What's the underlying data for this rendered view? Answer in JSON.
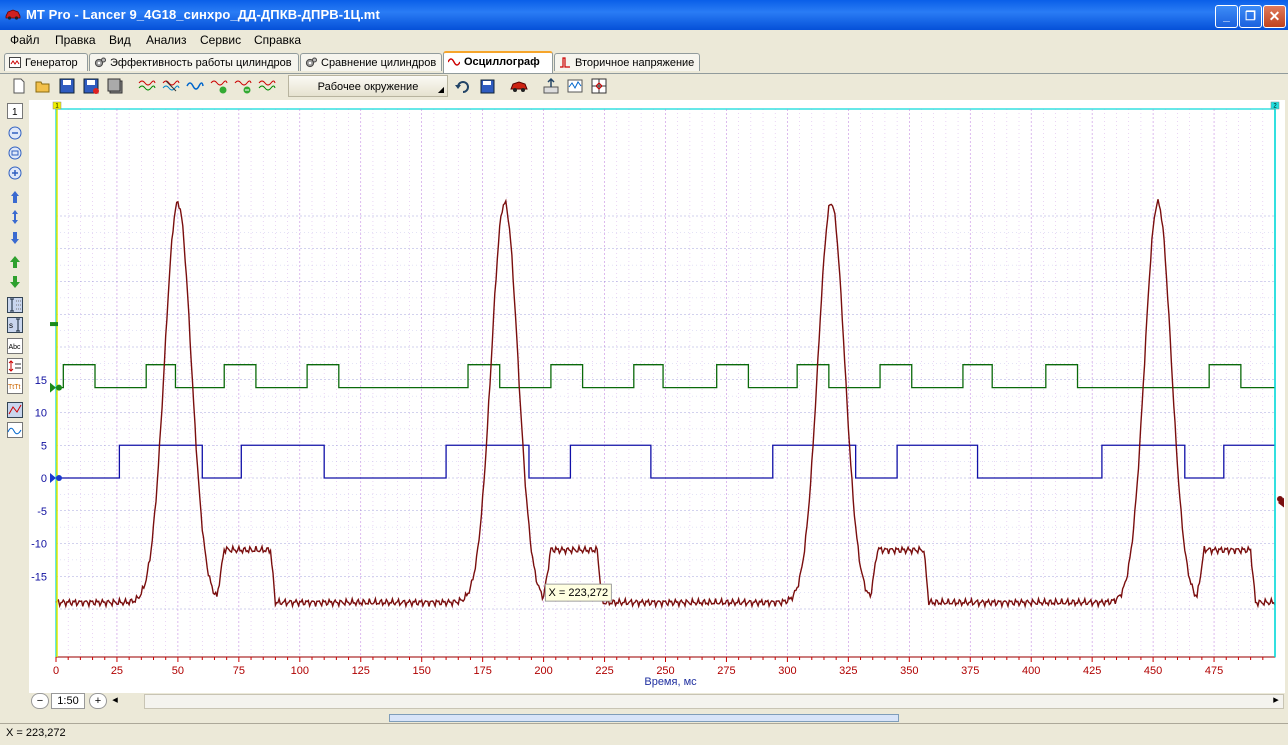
{
  "window": {
    "title": "MT Pro - Lancer 9_4G18_синхро_ДД-ДПКВ-ДПРВ-1Ц.mt",
    "buttons": [
      "minimize-icon",
      "restore-icon",
      "close-icon"
    ]
  },
  "menu": [
    "Файл",
    "Правка",
    "Вид",
    "Анализ",
    "Сервис",
    "Справка"
  ],
  "tabs": [
    {
      "label": "Генератор",
      "icon": "generator-icon"
    },
    {
      "label": "Эффективность работы цилиндров",
      "icon": "gears-icon"
    },
    {
      "label": "Сравнение цилиндров",
      "icon": "gears-icon"
    },
    {
      "label": "Осциллограф",
      "icon": "sine-wave-icon",
      "active": true
    },
    {
      "label": "Вторичное напряжение",
      "icon": "spark-icon"
    }
  ],
  "toolbar": {
    "workspace_label": "Рабочее окружение",
    "icons": [
      "new-file-icon",
      "open-folder-icon",
      "save-icon",
      "save-as-icon",
      "save-all-icon",
      "wave-1-icon",
      "wave-2-icon",
      "wave-3-icon",
      "wave-4-icon",
      "wave-5-icon",
      "undo-icon",
      "save-layout-icon",
      "car-icon",
      "export-icon",
      "chart-icon",
      "grid-icon"
    ]
  },
  "left_tools": [
    "channel-1-icon",
    "zoom-out-icon",
    "zoom-fit-icon",
    "zoom-in-icon",
    "shift-up-icon",
    "spread-icon",
    "shift-down-icon",
    "move-up-icon",
    "move-down-icon",
    "cursor-icon",
    "marker-icon",
    "label-icon",
    "measure-icon",
    "text-icon",
    "chart-view-icon",
    "signal-view-icon"
  ],
  "chart": {
    "cursor_readout": "X = 223,272",
    "markers": {
      "left": "1",
      "right": "2"
    },
    "colors": {
      "blue": "#1010a8",
      "green": "#0a6a0a",
      "red": "#7a0e0e",
      "grid": "#c080e0",
      "axis": "#cc0000",
      "cursor_left": "#e8e800",
      "cursor_right": "#00d8d8"
    }
  },
  "chart_data": {
    "type": "line",
    "xlabel": "Время, мс",
    "ylabel": "",
    "xlim": [
      0,
      500
    ],
    "x_ticks": [
      0,
      25,
      50,
      75,
      100,
      125,
      150,
      175,
      200,
      225,
      250,
      275,
      300,
      325,
      350,
      375,
      400,
      425,
      450,
      475
    ],
    "x_tick_labels": [
      "0",
      "25",
      "50",
      "75",
      "100",
      "125",
      "150",
      "175",
      "200",
      "225",
      "250",
      "275",
      "300",
      "325",
      "350",
      "375",
      "400",
      "425",
      "450",
      "475"
    ],
    "y_ticks": [
      15,
      10,
      5,
      0,
      -5,
      -10,
      -15
    ],
    "y_tick_labels": [
      "15",
      "10",
      "5",
      "0",
      "-5",
      "-10",
      "-15"
    ],
    "series": [
      {
        "color": "#0a6a0a",
        "low": 13.8,
        "high": 17.3,
        "high_intervals": [
          [
            3,
            16
          ],
          [
            37,
            49
          ],
          [
            69,
            82
          ],
          [
            103,
            116
          ],
          [
            169,
            182
          ],
          [
            203,
            216
          ],
          [
            237,
            249
          ],
          [
            271,
            284
          ],
          [
            304,
            317
          ],
          [
            338,
            351
          ],
          [
            372,
            384
          ],
          [
            406,
            419
          ],
          [
            473,
            486
          ]
        ]
      },
      {
        "color": "#1010a8",
        "low": 0,
        "high": 5,
        "high_intervals": [
          [
            26,
            60
          ],
          [
            76,
            110
          ],
          [
            160,
            194
          ],
          [
            211,
            244
          ],
          [
            294,
            328
          ],
          [
            345,
            378
          ],
          [
            429,
            463
          ],
          [
            479,
            500
          ]
        ]
      },
      {
        "color": "#7a0e0e",
        "description": "periodic peaks",
        "peak_x": [
          50,
          184,
          318,
          452
        ],
        "peak_value": 42,
        "baseline": -19,
        "plateau_value": -11
      }
    ]
  },
  "bottom": {
    "zoom_level": "1:50",
    "status": "X = 223,272"
  }
}
